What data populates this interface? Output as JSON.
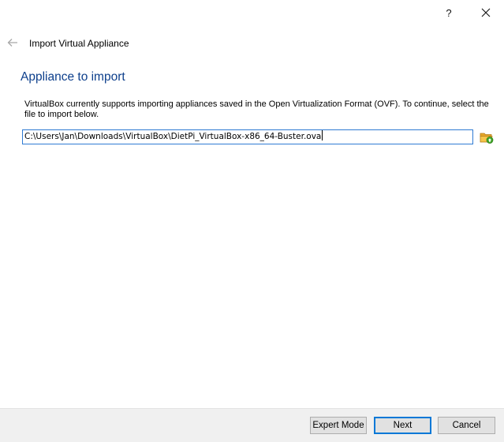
{
  "titlebar": {
    "help_label": "?",
    "close_icon": "close-icon"
  },
  "header": {
    "back_icon": "arrow-left-icon",
    "window_title": "Import Virtual Appliance"
  },
  "main": {
    "page_title": "Appliance to import",
    "description": "VirtualBox currently supports importing appliances saved in the Open Virtualization Format (OVF). To continue, select the file to import below.",
    "file_path": "C:\\Users\\Jan\\Downloads\\VirtualBox\\DietPi_VirtualBox-x86_64-Buster.ova",
    "browse_icon": "folder-open-icon"
  },
  "footer": {
    "expert_mode_label": "Expert Mode",
    "next_label": "Next",
    "cancel_label": "Cancel"
  },
  "colors": {
    "title_blue": "#0d3f8c",
    "focus_border": "#0078d7",
    "footer_bg": "#f0f0f0"
  }
}
